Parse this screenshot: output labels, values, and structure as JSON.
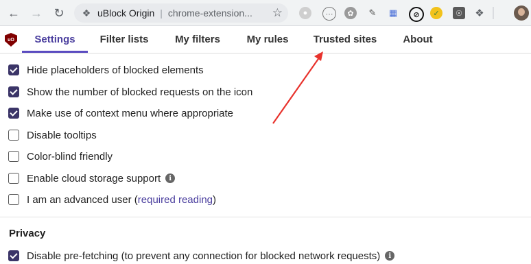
{
  "browser": {
    "site_name": "uBlock Origin",
    "separator": "|",
    "url": "chrome-extension...",
    "back_icon": "arrow-left-icon",
    "forward_icon": "arrow-right-icon",
    "reload_icon": "reload-icon",
    "star_icon": "bookmark-star-icon",
    "extensions_icon": "puzzle-icon"
  },
  "tabs": [
    {
      "label": "Settings",
      "active": true
    },
    {
      "label": "Filter lists"
    },
    {
      "label": "My filters"
    },
    {
      "label": "My rules"
    },
    {
      "label": "Trusted sites"
    },
    {
      "label": "About"
    }
  ],
  "options": [
    {
      "label": "Hide placeholders of blocked elements",
      "checked": true
    },
    {
      "label": "Show the number of blocked requests on the icon",
      "checked": true
    },
    {
      "label": "Make use of context menu where appropriate",
      "checked": true
    },
    {
      "label": "Disable tooltips",
      "checked": false
    },
    {
      "label": "Color-blind friendly",
      "checked": false
    },
    {
      "label": "Enable cloud storage support",
      "checked": false
    },
    {
      "label_before": "I am an advanced user (",
      "link": "required reading",
      "label_after": ")",
      "checked": false
    }
  ],
  "privacy": {
    "heading": "Privacy",
    "option": {
      "label": "Disable pre-fetching (to prevent any connection for blocked network requests)",
      "checked": true
    }
  },
  "info_glyph": "i",
  "logo_text": "uO",
  "colors": {
    "accent": "#4a3e9e",
    "checkbox": "#3b3568",
    "arrow": "#e8322c",
    "logo": "#800000"
  }
}
